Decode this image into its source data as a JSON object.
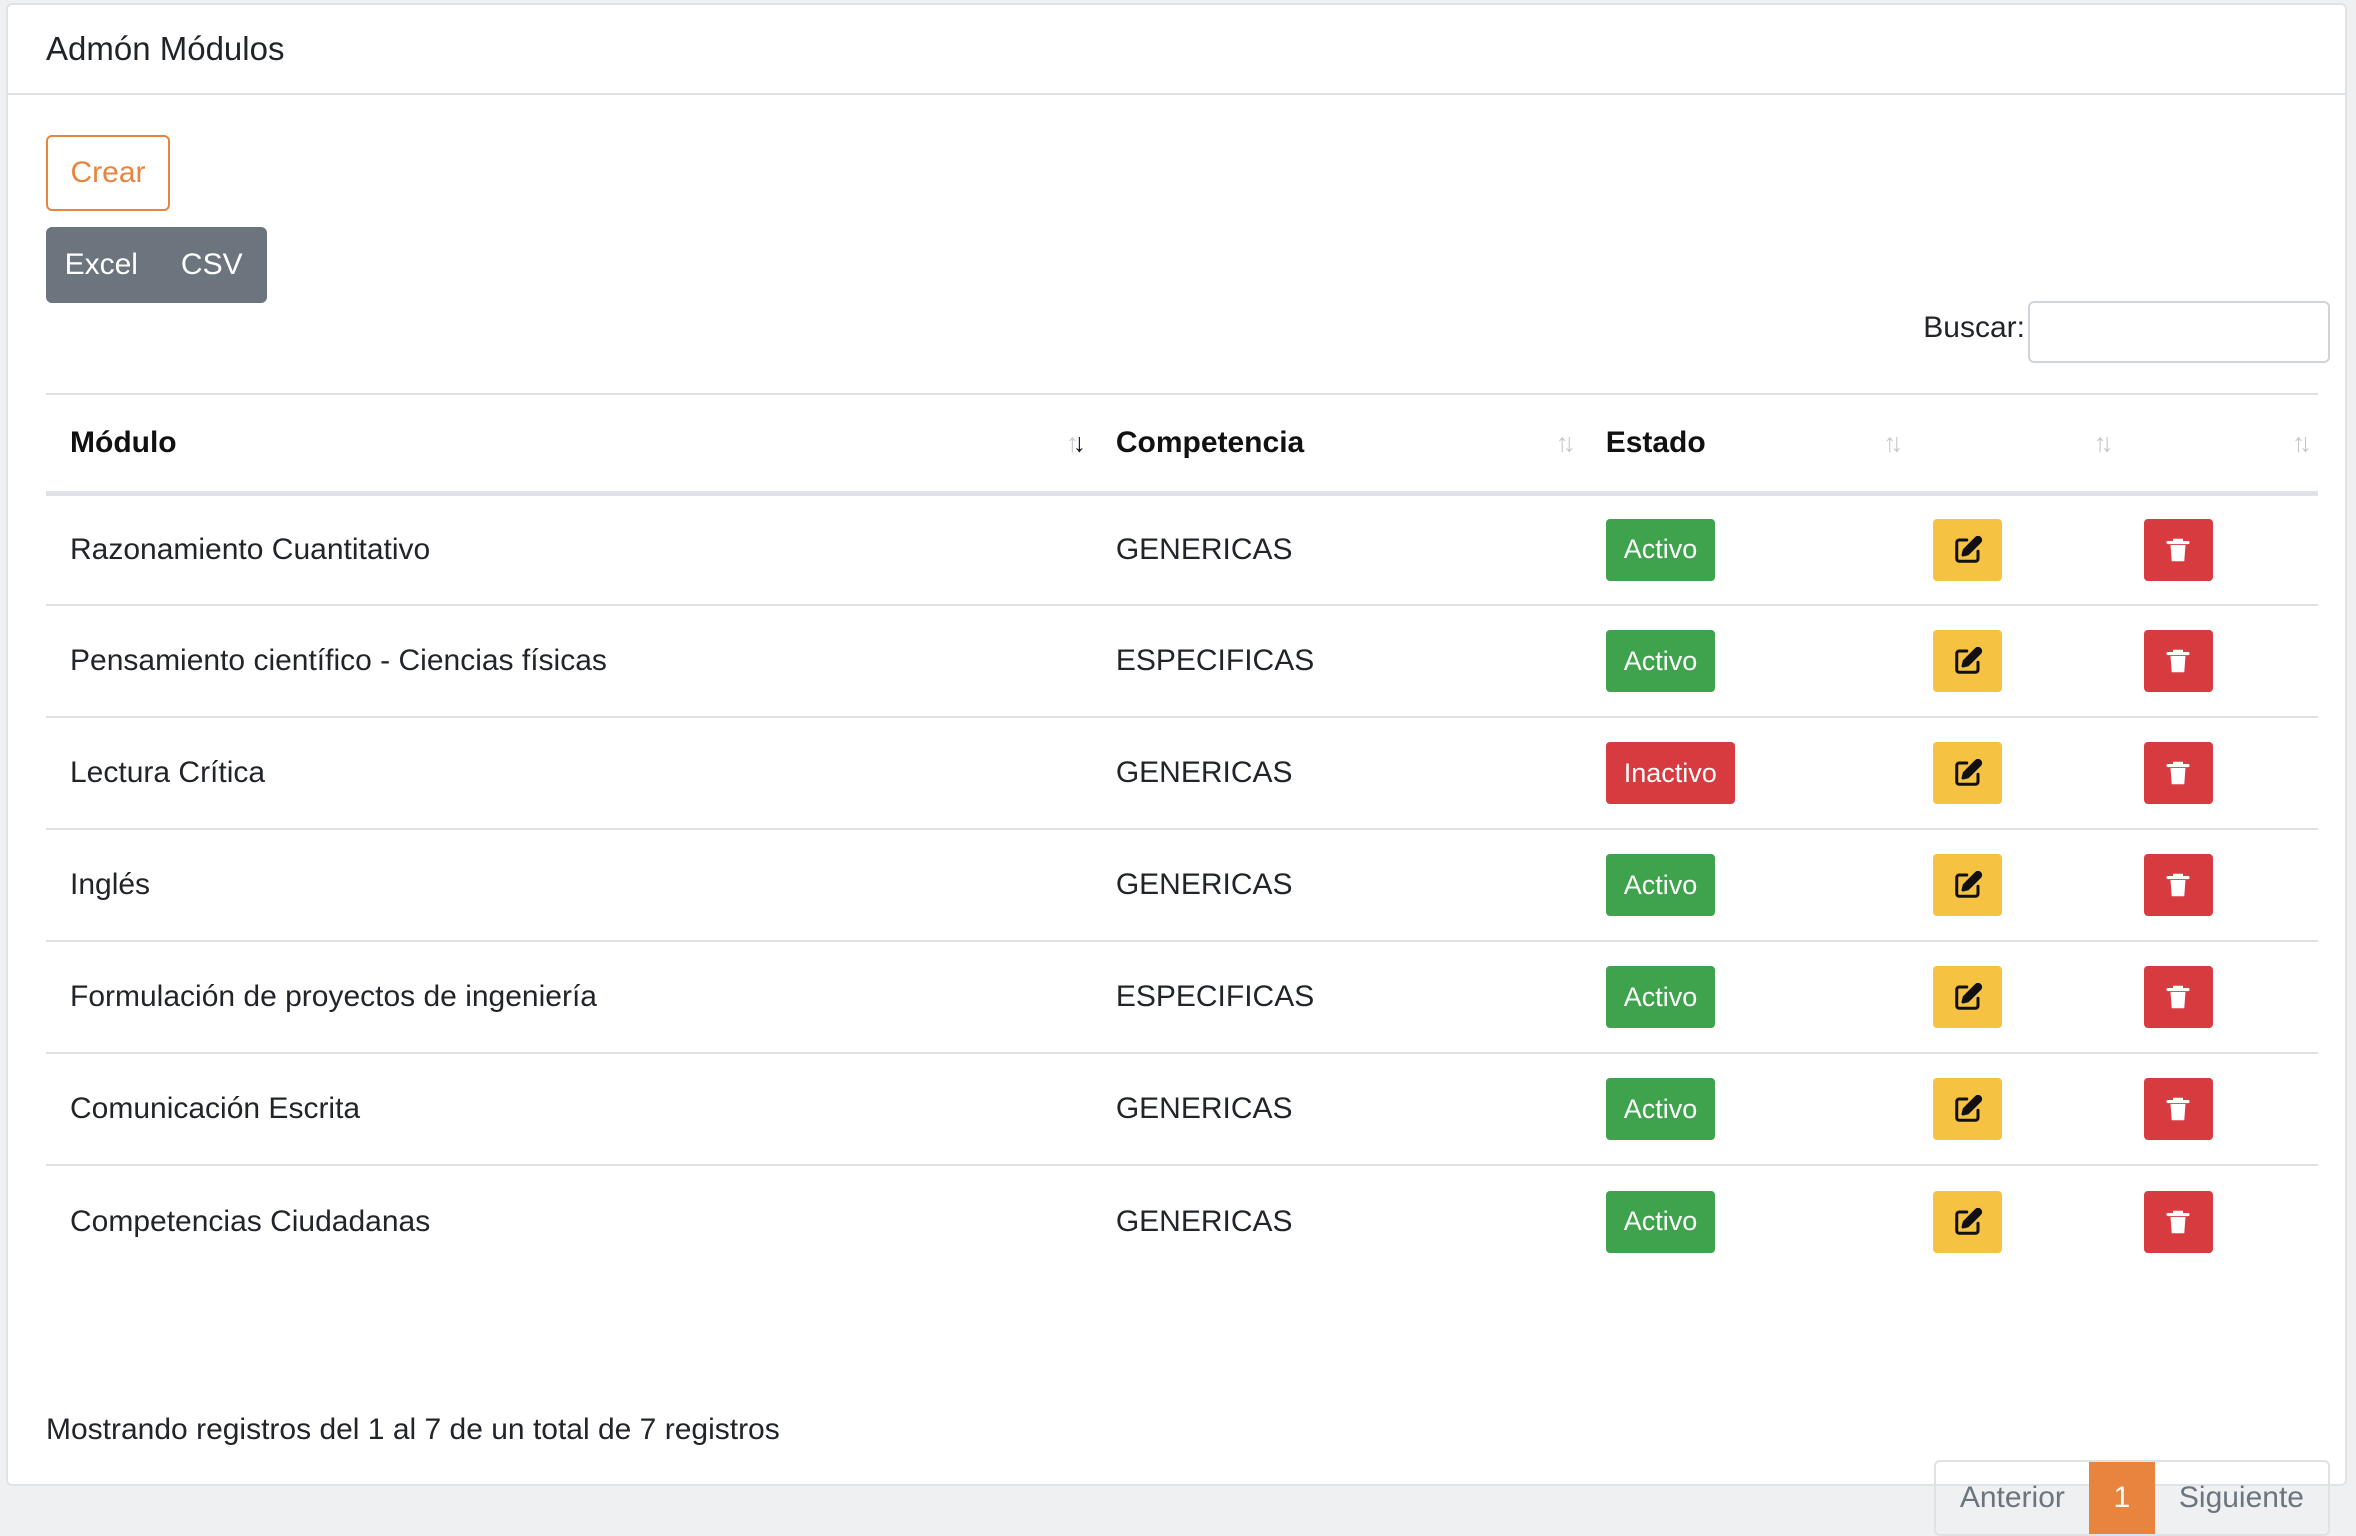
{
  "header": {
    "title": "Admón Módulos"
  },
  "toolbar": {
    "create_label": "Crear",
    "export": [
      "Excel",
      "CSV"
    ]
  },
  "search": {
    "label": "Buscar:",
    "value": "",
    "placeholder": ""
  },
  "table": {
    "columns": [
      {
        "label": "Módulo",
        "sort": "desc"
      },
      {
        "label": "Competencia",
        "sort": "none"
      },
      {
        "label": "Estado",
        "sort": "none"
      },
      {
        "label": "",
        "sort": "none"
      },
      {
        "label": "",
        "sort": "none"
      }
    ],
    "rows": [
      {
        "modulo": "Razonamiento Cuantitativo",
        "competencia": "GENERICAS",
        "estado": "Activo"
      },
      {
        "modulo": "Pensamiento científico - Ciencias físicas",
        "competencia": "ESPECIFICAS",
        "estado": "Activo"
      },
      {
        "modulo": "Lectura Crítica",
        "competencia": "GENERICAS",
        "estado": "Inactivo"
      },
      {
        "modulo": "Inglés",
        "competencia": "GENERICAS",
        "estado": "Activo"
      },
      {
        "modulo": "Formulación de proyectos de ingeniería",
        "competencia": "ESPECIFICAS",
        "estado": "Activo"
      },
      {
        "modulo": "Comunicación Escrita",
        "competencia": "GENERICAS",
        "estado": "Activo"
      },
      {
        "modulo": "Competencias Ciudadanas",
        "competencia": "GENERICAS",
        "estado": "Activo"
      }
    ],
    "actions": {
      "edit_icon": "edit-icon",
      "delete_icon": "trash-icon"
    }
  },
  "footer": {
    "info": "Mostrando registros del 1 al 7 de un total de 7 registros",
    "pagination": {
      "prev": "Anterior",
      "current": "1",
      "next": "Siguiente"
    }
  },
  "colors": {
    "accent": "#e8843e",
    "active": "#3fa34d",
    "inactive": "#d73a3f",
    "edit": "#f5c242",
    "delete": "#d73a3f",
    "secondary": "#6c757d"
  }
}
